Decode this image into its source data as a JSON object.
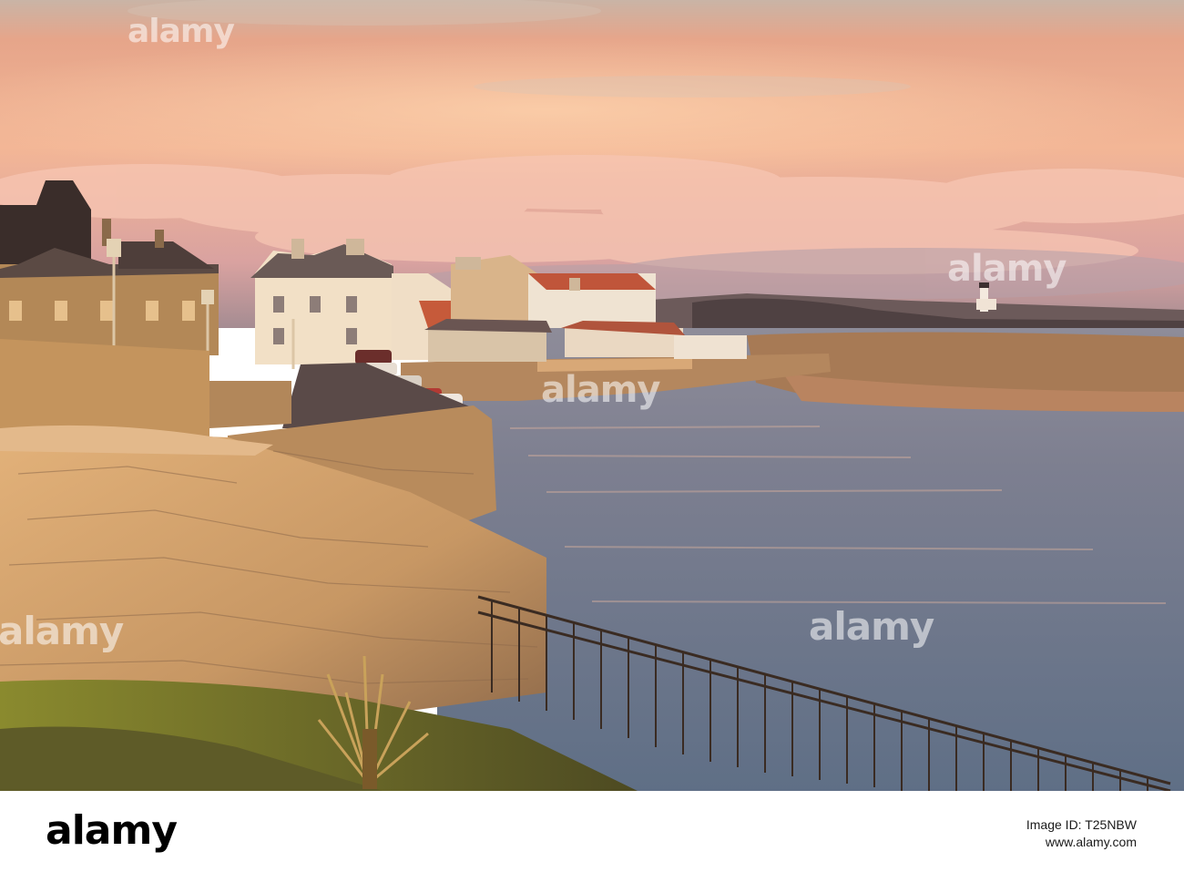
{
  "watermark": {
    "brand": "alamy"
  },
  "footer": {
    "logo_text": "alamy",
    "image_id_label": "Image ID: T25NBW",
    "site_url": "www.alamy.com"
  },
  "colors": {
    "sky_top": "#e9a88a",
    "sky_glow": "#f6c29b",
    "sea": "#6f7e93",
    "stone_wall": "#c99862",
    "grass": "#6a6a2c"
  }
}
